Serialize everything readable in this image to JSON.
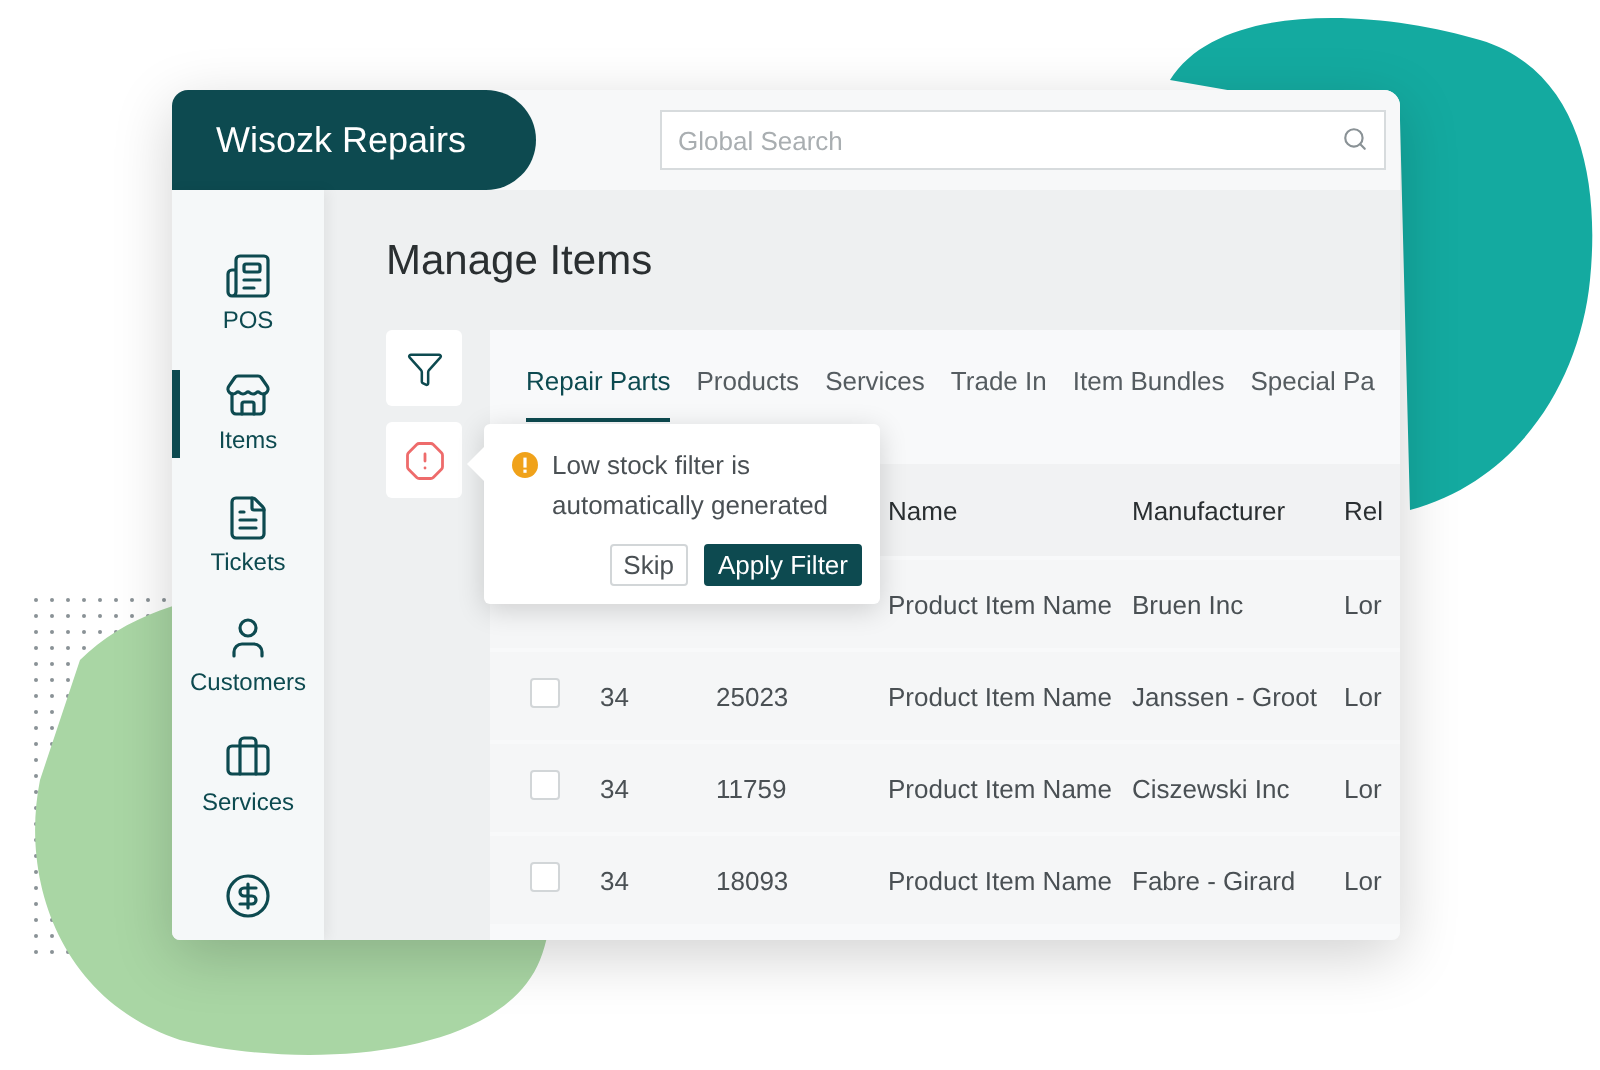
{
  "brand": "Wisozk Repairs",
  "search": {
    "placeholder": "Global Search"
  },
  "sidebar": {
    "items": [
      {
        "label": "POS",
        "selected": false
      },
      {
        "label": "Items",
        "selected": true
      },
      {
        "label": "Tickets",
        "selected": false
      },
      {
        "label": "Customers",
        "selected": false
      },
      {
        "label": "Services",
        "selected": false
      },
      {
        "selected": false
      }
    ]
  },
  "page_title": "Manage Items",
  "tool_buttons": [
    {
      "kind": "filter"
    },
    {
      "kind": "alert"
    }
  ],
  "tabs": [
    {
      "label": "Repair Parts",
      "selected": true
    },
    {
      "label": "Products",
      "selected": false
    },
    {
      "label": "Services",
      "selected": false
    },
    {
      "label": "Trade In",
      "selected": false
    },
    {
      "label": "Item Bundles",
      "selected": false
    },
    {
      "label": "Special Pa",
      "selected": false
    }
  ],
  "table": {
    "columns": [
      "Name",
      "Manufacturer",
      "Rel"
    ],
    "rows": [
      {
        "name": "Product Item Name",
        "manufacturer": "Bruen Inc",
        "column_6": "Lor"
      },
      {
        "checked": false,
        "qty": "34",
        "id": "25023",
        "name": "Product Item Name",
        "manufacturer": "Janssen - Groot",
        "column_6": "Lor"
      },
      {
        "checked": false,
        "qty": "34",
        "id": "11759",
        "name": "Product Item Name",
        "manufacturer": "Ciszewski Inc",
        "column_6": "Lor"
      },
      {
        "checked": false,
        "qty": "34",
        "id": "18093",
        "name": "Product Item Name",
        "manufacturer": "Fabre - Girard",
        "column_6": "Lor"
      }
    ]
  },
  "popover": {
    "message": "Low stock filter is automatically generated",
    "buttons": [
      {
        "label": "Skip",
        "kind": "secondary"
      },
      {
        "label": "Apply Filter",
        "kind": "primary"
      }
    ]
  }
}
